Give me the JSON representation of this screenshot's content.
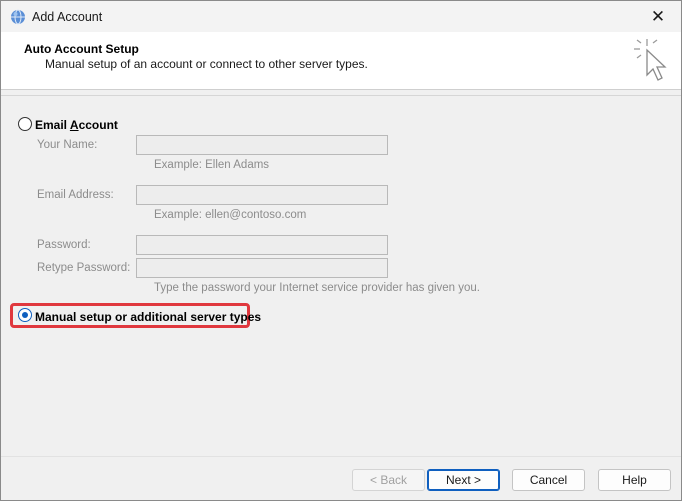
{
  "window": {
    "title": "Add Account",
    "close_glyph": "✕"
  },
  "header": {
    "title": "Auto Account Setup",
    "subtitle": "Manual setup of an account or connect to other server types."
  },
  "options": {
    "email_account": {
      "label_pre": "Email ",
      "label_accel": "A",
      "label_post": "ccount",
      "selected": false
    },
    "manual_setup": {
      "label": "Manual setup or additional server types",
      "selected": true
    }
  },
  "fields": {
    "your_name": {
      "label": "Your Name:",
      "value": "",
      "hint": "Example: Ellen Adams"
    },
    "email_address": {
      "label": "Email Address:",
      "value": "",
      "hint": "Example: ellen@contoso.com"
    },
    "password": {
      "label": "Password:",
      "value": ""
    },
    "retype_password": {
      "label": "Retype Password:",
      "value": ""
    },
    "password_hint": "Type the password your Internet service provider has given you."
  },
  "buttons": {
    "back": "< Back",
    "next": "Next >",
    "cancel": "Cancel",
    "help": "Help"
  },
  "colors": {
    "accent": "#0f5fbf",
    "highlight": "#e0383e"
  },
  "icons": [
    "outlook-globe-icon",
    "close-icon",
    "cursor-sparkle-icon"
  ]
}
